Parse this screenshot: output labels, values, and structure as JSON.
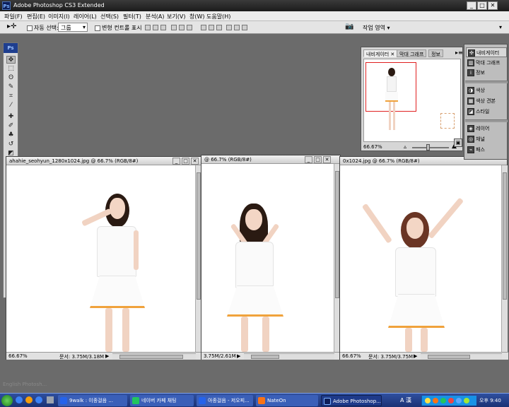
{
  "app": {
    "title": "Adobe Photoshop CS3 Extended",
    "logo": "Ps"
  },
  "menu": [
    "파일(F)",
    "편집(E)",
    "이미지(I)",
    "레이어(L)",
    "선택(S)",
    "필터(T)",
    "분석(A)",
    "보기(V)",
    "창(W)",
    "도움말(H)"
  ],
  "options": {
    "auto_select_label": "자동 선택:",
    "auto_select_value": "그룹",
    "transform_label": "변형 컨트롤 표시",
    "workspace_label": "작업 영역"
  },
  "documents": [
    {
      "title": "ahahie_seohyun_1280x1024.jpg @ 66.7% (RGB/8#)",
      "zoom": "66.67%",
      "status": "문서: 3.75M/3.18M"
    },
    {
      "title": "@ 66.7% (RGB/8#)",
      "zoom": "",
      "status": "3.75M/2.61M"
    },
    {
      "title": "0x1024.jpg @ 66.7% (RGB/8#)",
      "zoom": "66.67%",
      "status": "문서: 3.75M/3.75M"
    }
  ],
  "navigator": {
    "tabs": [
      "내비게이터",
      "막대 그래프",
      "정보"
    ],
    "zoom": "66.67%"
  },
  "dock": {
    "groups": [
      [
        "내비게이터",
        "막대 그래프",
        "정보"
      ],
      [
        "색상",
        "색상 견본",
        "스타일"
      ],
      [
        "레이어",
        "채널",
        "패스"
      ]
    ]
  },
  "background_text": "English   Photosh...",
  "taskbar": {
    "items": [
      "9walk : 이종걸음 ...",
      "네이버 카페 채팅",
      "아종걸음 - 저오피...",
      "NateOn",
      "Adobe Photoshop..."
    ],
    "clock": "오후 9:40",
    "ime": "A 漢"
  }
}
